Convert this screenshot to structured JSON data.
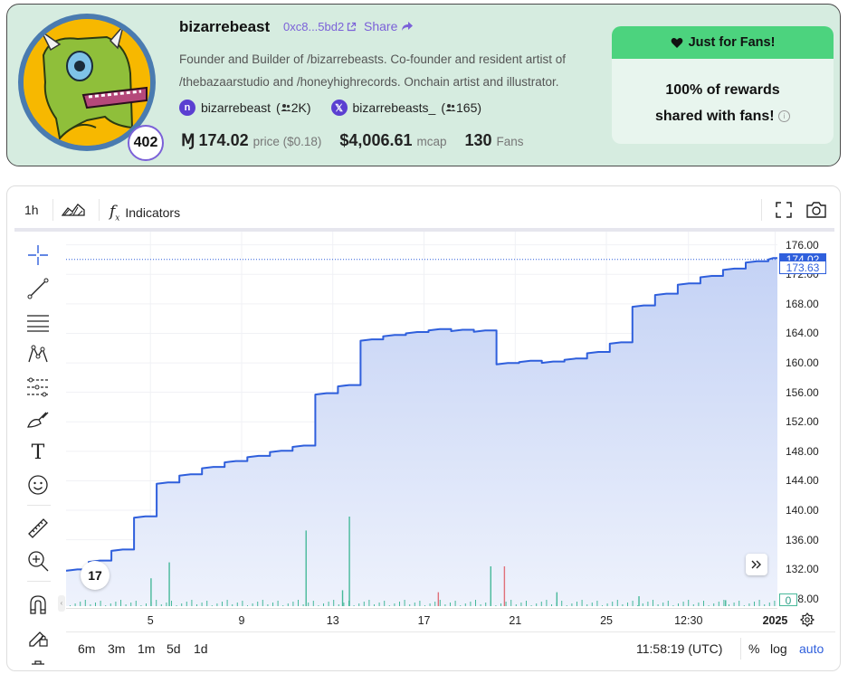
{
  "profile": {
    "name": "bizarrebeast",
    "address": "0xc8...5bd2",
    "share_label": "Share",
    "bio": "Founder and Builder of /bizarrebeasts. Co-founder and resident artist of /thebazaarstudio and /honeyhighrecords. Onchain artist and illustrator.",
    "fan_badge": "402",
    "farcaster": {
      "handle": "bizarrebeast",
      "followers": "2K"
    },
    "x": {
      "handle": "bizarrebeasts_",
      "followers": "165"
    },
    "stats": {
      "price": "174.02",
      "price_label": "price",
      "price_usd": "($0.18)",
      "mcap": "$4,006.61",
      "mcap_label": "mcap",
      "fans": "130",
      "fans_label": "Fans"
    },
    "fans_box": {
      "title": "Just for Fans!",
      "line1": "100% of rewards",
      "line2": "shared with fans!"
    },
    "colors": {
      "card_bg": "#d6ece0",
      "accent": "#7b61d8",
      "fans_green": "#4cd37e"
    }
  },
  "toolbar": {
    "interval": "1h",
    "indicators_label": "Indicators"
  },
  "bottom": {
    "ranges": [
      "6m",
      "3m",
      "1m",
      "5d",
      "1d"
    ],
    "clock": "11:58:19 (UTC)",
    "percent_label": "%",
    "log_label": "log",
    "auto_label": "auto"
  },
  "chart_data": {
    "type": "area",
    "series": [
      {
        "x": [
          "Dec 2",
          "Dec 3",
          "Dec 4",
          "Dec 5",
          "Dec 6",
          "Dec 7",
          "Dec 8",
          "Dec 9",
          "Dec 10",
          "Dec 11",
          "Dec 12",
          "Dec 13",
          "Dec 14",
          "Dec 15",
          "Dec 16",
          "Dec 17",
          "Dec 18",
          "Dec 19",
          "Dec 20",
          "Dec 21",
          "Dec 22",
          "Dec 23",
          "Dec 24",
          "Dec 25",
          "Dec 26",
          "Dec 27",
          "Dec 28",
          "Dec 29",
          "Dec 30",
          "Dec 31",
          "Jan 1",
          "Jan 2"
        ],
        "values": [
          131.8,
          133.0,
          134.5,
          139.0,
          143.6,
          144.7,
          145.7,
          146.5,
          147.2,
          147.9,
          148.6,
          155.7,
          156.8,
          163.0,
          163.6,
          164.0,
          164.4,
          164.3,
          164.2,
          159.8,
          160.1,
          160.0,
          160.4,
          161.3,
          162.6,
          167.6,
          169.2,
          170.6,
          171.6,
          172.6,
          173.6,
          174.02
        ]
      }
    ],
    "y_ticks": [
      "176.00",
      "172.00",
      "168.00",
      "164.00",
      "160.00",
      "156.00",
      "152.00",
      "148.00",
      "144.00",
      "140.00",
      "136.00",
      "132.00",
      "128.00"
    ],
    "ylim": [
      127,
      177.8
    ],
    "x_ticks": [
      "5",
      "9",
      "13",
      "17",
      "21",
      "25",
      "12:30",
      "2025"
    ],
    "last_price_label": "174.02",
    "prev_price_label": "173.63",
    "volume_label": "0",
    "volume": [
      {
        "day": 5.0,
        "v": 0.14,
        "c": "green"
      },
      {
        "day": 5.8,
        "v": 0.22,
        "c": "green"
      },
      {
        "day": 11.8,
        "v": 0.38,
        "c": "green"
      },
      {
        "day": 13.7,
        "v": 0.45,
        "c": "green"
      },
      {
        "day": 13.4,
        "v": 0.08,
        "c": "green"
      },
      {
        "day": 17.6,
        "v": 0.07,
        "c": "red"
      },
      {
        "day": 19.9,
        "v": 0.2,
        "c": "green"
      },
      {
        "day": 20.5,
        "v": 0.2,
        "c": "red"
      },
      {
        "day": 22.8,
        "v": 0.07,
        "c": "green"
      },
      {
        "day": 26.4,
        "v": 0.05,
        "c": "green"
      },
      {
        "day": 30.2,
        "v": 0.03,
        "c": "green"
      }
    ],
    "colors": {
      "line": "#2f5fdc",
      "fill_top": "#c4d2f5",
      "fill_bottom": "#eef2fc",
      "vol_green": "#47b99a",
      "vol_red": "#e0707a"
    }
  }
}
